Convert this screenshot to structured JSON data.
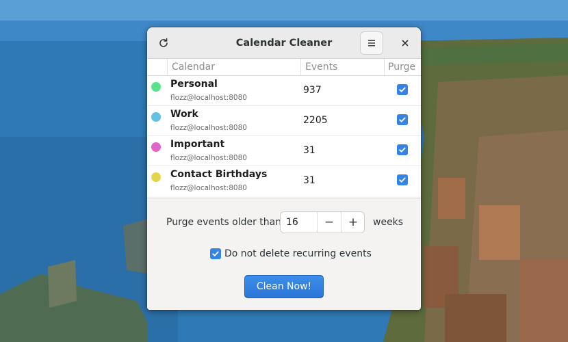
{
  "window": {
    "title": "Calendar Cleaner",
    "refresh_icon": "refresh-icon",
    "menu_icon": "hamburger-menu-icon",
    "close_icon": "close-icon"
  },
  "table": {
    "columns": [
      "Calendar",
      "Events",
      "Purge"
    ],
    "rows": [
      {
        "name": "Personal",
        "owner": "flozz@localhost:8080",
        "events": "937",
        "purge": true,
        "color": "#57e389"
      },
      {
        "name": "Work",
        "owner": "flozz@localhost:8080",
        "events": "2205",
        "purge": true,
        "color": "#62c0e4"
      },
      {
        "name": "Important",
        "owner": "flozz@localhost:8080",
        "events": "31",
        "purge": true,
        "color": "#e066c9"
      },
      {
        "name": "Contact Birthdays",
        "owner": "flozz@localhost:8080",
        "events": "31",
        "purge": true,
        "color": "#e5d44a"
      }
    ]
  },
  "options": {
    "purge_label": "Purge events older than",
    "weeks_value": "16",
    "minus_label": "−",
    "plus_label": "+",
    "weeks_label": "weeks",
    "recurring_label": "Do not delete recurring events",
    "recurring_checked": true,
    "clean_button": "Clean Now!"
  },
  "colors": {
    "accent": "#3584e4",
    "headerbar": "#ebebeb"
  }
}
